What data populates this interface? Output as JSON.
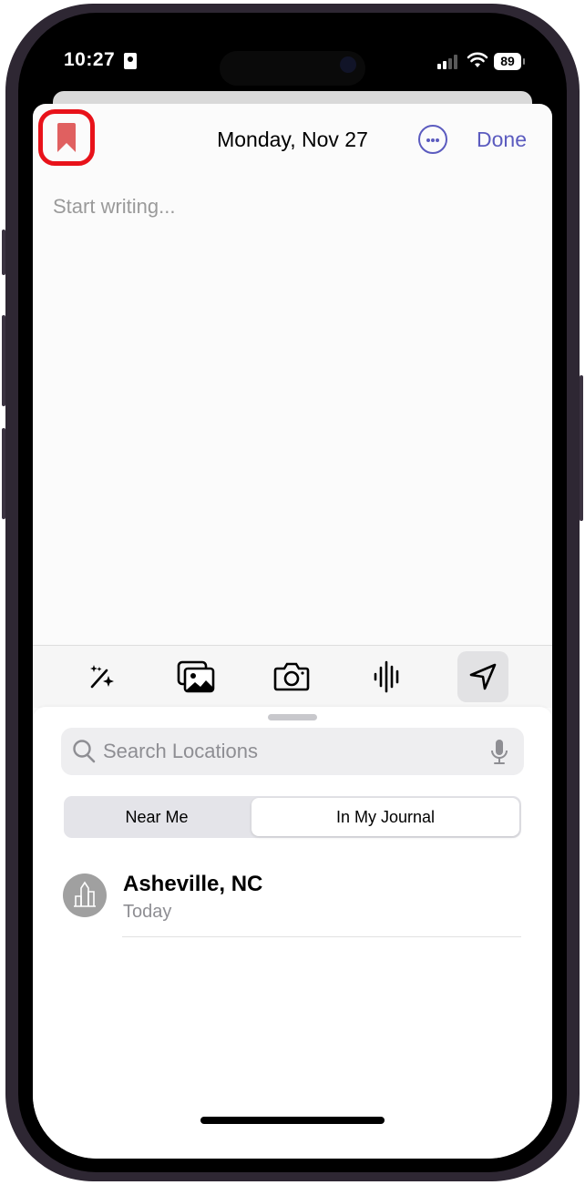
{
  "status_bar": {
    "time": "10:27",
    "battery": "89"
  },
  "header": {
    "title": "Monday, Nov 27",
    "done_label": "Done",
    "bookmark_icon": "bookmark-icon",
    "more_icon": "ellipsis-circle-icon"
  },
  "editor": {
    "placeholder": "Start writing..."
  },
  "toolbar": {
    "items": [
      {
        "icon": "magic-wand-sparkles-icon",
        "active": false
      },
      {
        "icon": "photo-library-icon",
        "active": false
      },
      {
        "icon": "camera-icon",
        "active": false
      },
      {
        "icon": "audio-waveform-icon",
        "active": false
      },
      {
        "icon": "location-arrow-icon",
        "active": true
      }
    ]
  },
  "location_panel": {
    "search_placeholder": "Search Locations",
    "segments": [
      {
        "label": "Near Me",
        "selected": false
      },
      {
        "label": "In My Journal",
        "selected": true
      }
    ],
    "results": [
      {
        "name": "Asheville, NC",
        "subtitle": "Today",
        "icon": "city-buildings-icon"
      }
    ]
  },
  "colors": {
    "accent": "#5b5bbf",
    "bookmark": "#e06060",
    "highlight_ring": "#e8121a"
  }
}
